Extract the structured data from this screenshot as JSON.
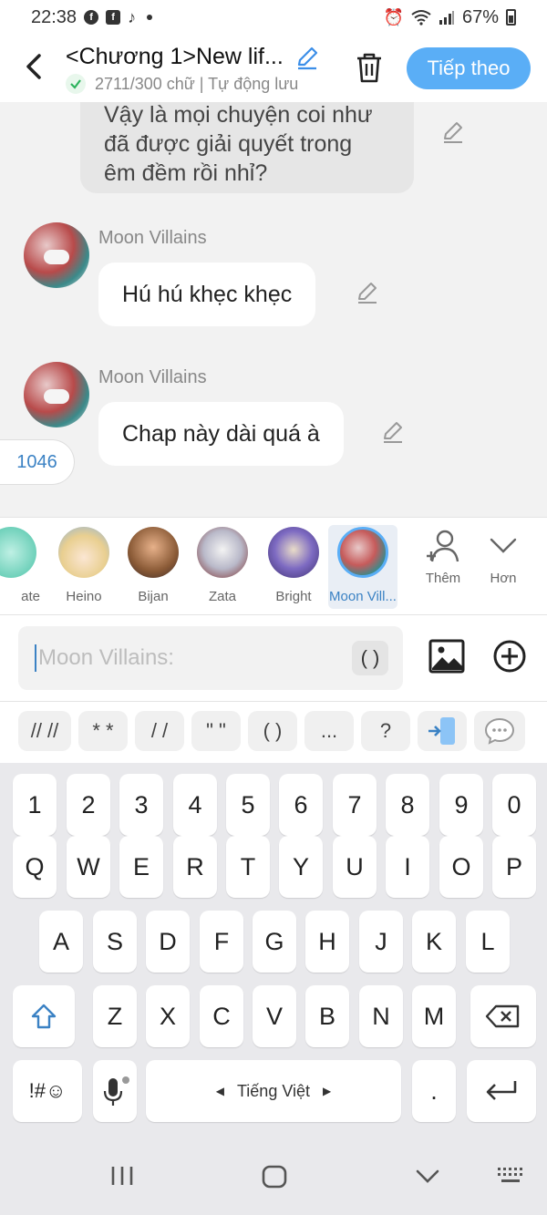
{
  "status_bar": {
    "time": "22:38",
    "battery": "67%"
  },
  "header": {
    "title": "<Chương 1>New lif...",
    "subtitle": "2711/300 chữ | Tự động lưu",
    "next_label": "Tiếp theo"
  },
  "chat": {
    "previous_text_line1": "Vậy là mọi chuyện coi như",
    "previous_text_line2": "đã được giải quyết trong",
    "previous_text_line3": "êm đềm rồi nhỉ?",
    "messages": [
      {
        "speaker": "Moon Villains",
        "text": "Hú hú khẹc khẹc"
      },
      {
        "speaker": "Moon Villains",
        "text": "Chap này dài quá à"
      }
    ],
    "count_badge": "1046"
  },
  "characters": {
    "items": [
      {
        "name": "ate",
        "color": "#7fd6c2"
      },
      {
        "name": "Heino",
        "color": "#f2d9a8"
      },
      {
        "name": "Bijan",
        "color": "#b0834e"
      },
      {
        "name": "Zata",
        "color": "#c9c9d6"
      },
      {
        "name": "Bright",
        "color": "#6b5aa8"
      },
      {
        "name": "Moon Vill...",
        "color": "#c65b5b"
      }
    ],
    "add_label": "Thêm",
    "more_label": "Hơn"
  },
  "input": {
    "placeholder": "Moon Villains:",
    "paren_label": "( )"
  },
  "quick_symbols": [
    "// //",
    "* *",
    "/ /",
    "\" \"",
    "( )",
    "...",
    "?"
  ],
  "keyboard": {
    "numbers": [
      "1",
      "2",
      "3",
      "4",
      "5",
      "6",
      "7",
      "8",
      "9",
      "0"
    ],
    "row1": [
      "Q",
      "W",
      "E",
      "R",
      "T",
      "Y",
      "U",
      "I",
      "O",
      "P"
    ],
    "row2": [
      "A",
      "S",
      "D",
      "F",
      "G",
      "H",
      "J",
      "K",
      "L"
    ],
    "row3": [
      "Z",
      "X",
      "C",
      "V",
      "B",
      "N",
      "M"
    ],
    "symbols_label": "!#☺",
    "space_label": "Tiếng Việt",
    "period_label": "."
  },
  "colors": {
    "accent": "#5aaef6",
    "link": "#3b82c4"
  }
}
